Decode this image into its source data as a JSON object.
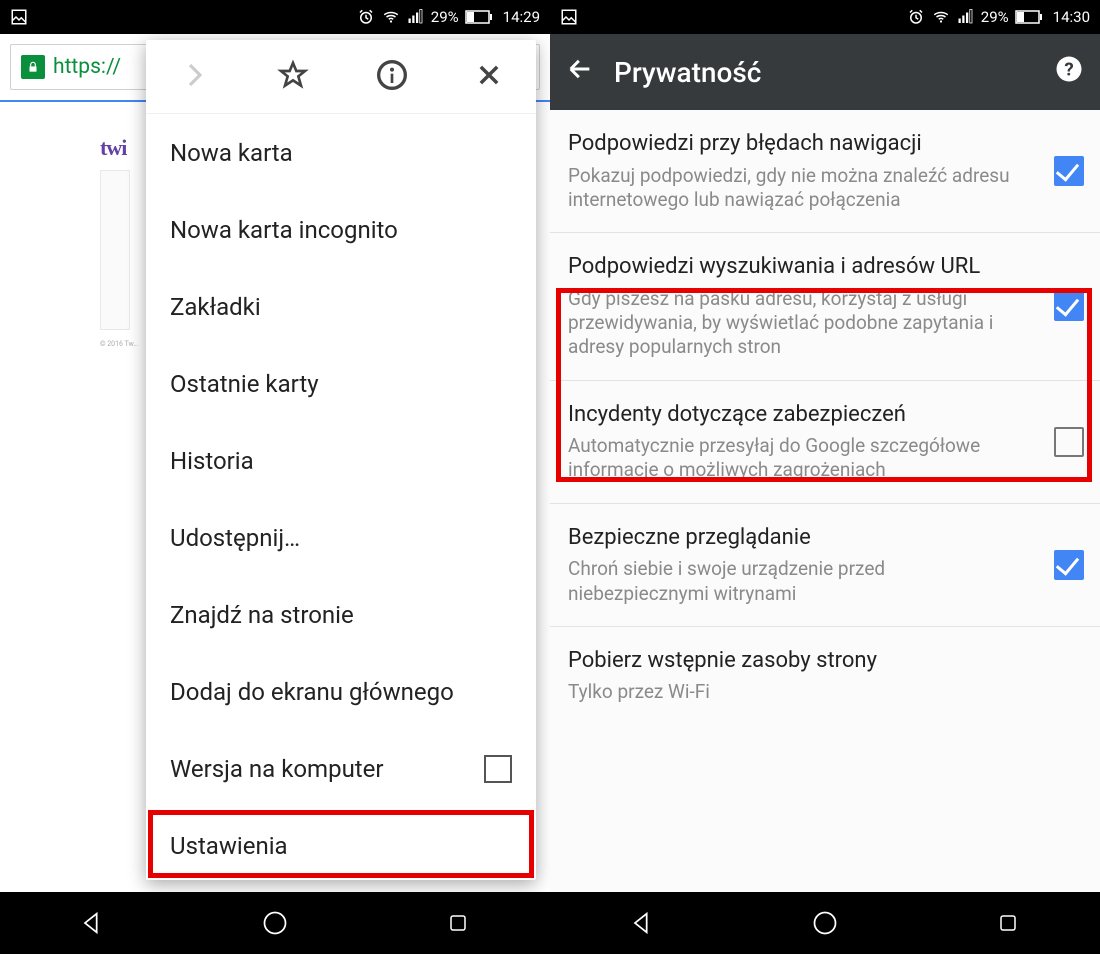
{
  "left": {
    "status": {
      "time": "14:29",
      "battery": "29%"
    },
    "url_scheme": "https://",
    "page_logo": "twi",
    "page_footer": "© 2016 Tw…",
    "menu": {
      "items": [
        "Nowa karta",
        "Nowa karta incognito",
        "Zakładki",
        "Ostatnie karty",
        "Historia",
        "Udostępnij…",
        "Znajdź na stronie",
        "Dodaj do ekranu głównego",
        "Wersja na komputer",
        "Ustawienia"
      ]
    }
  },
  "right": {
    "status": {
      "time": "14:30",
      "battery": "29%"
    },
    "appbar_title": "Prywatność",
    "settings": [
      {
        "title": "Podpowiedzi przy błędach nawigacji",
        "desc": "Pokazuj podpowiedzi, gdy nie można znaleźć adresu internetowego lub nawiązać połączenia",
        "checked": true
      },
      {
        "title": "Podpowiedzi wyszukiwania i adresów URL",
        "desc": "Gdy piszesz na pasku adresu, korzystaj z usługi przewidywania, by wyświetlać podobne zapytania i adresy popularnych stron",
        "checked": true
      },
      {
        "title": "Incydenty dotyczące zabezpieczeń",
        "desc": "Automatycznie przesyłaj do Google szczegółowe informacje o możliwych zagrożeniach",
        "checked": false
      },
      {
        "title": "Bezpieczne przeglądanie",
        "desc": "Chroń siebie i swoje urządzenie przed niebezpiecznymi witrynami",
        "checked": true
      },
      {
        "title": "Pobierz wstępnie zasoby strony",
        "desc": "Tylko przez Wi-Fi",
        "checked": null
      }
    ]
  }
}
